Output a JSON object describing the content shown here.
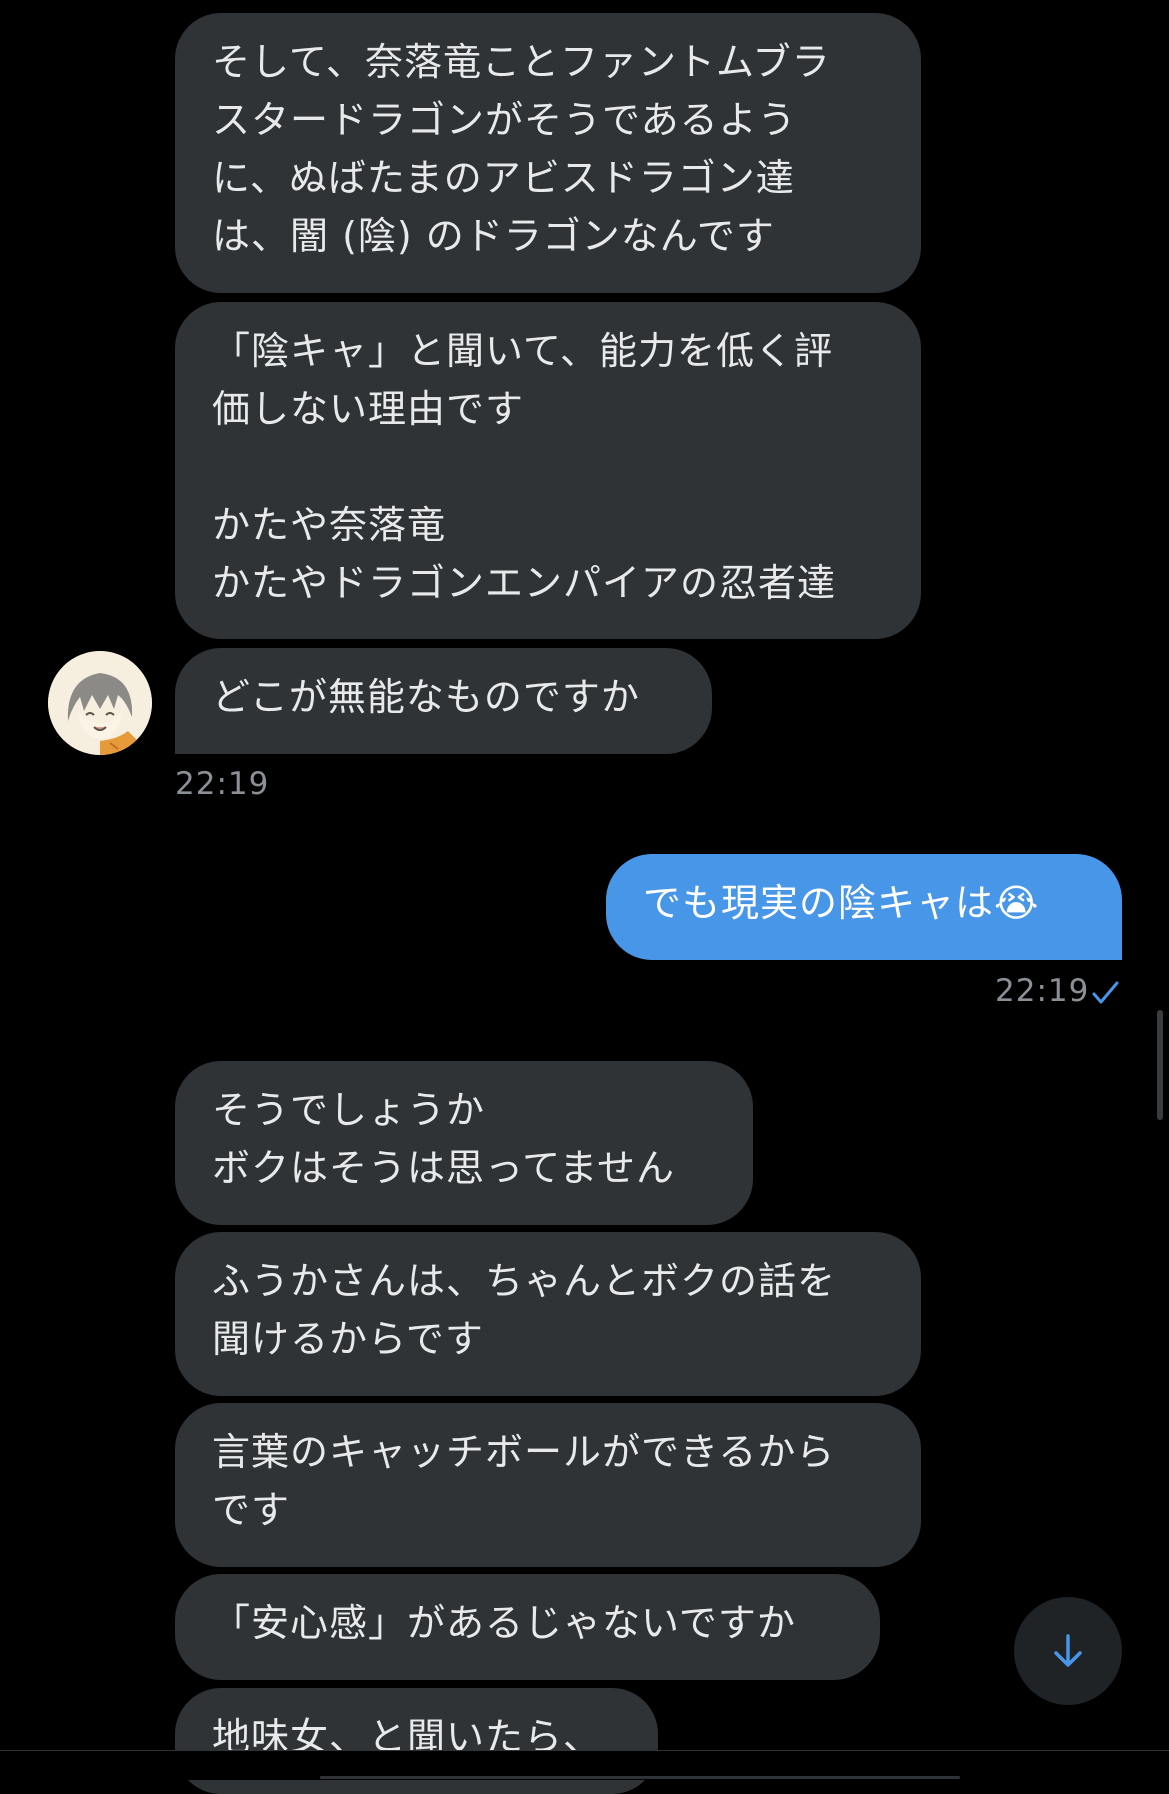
{
  "theme": {
    "background": "#000000",
    "incoming_bubble": "#2f3336",
    "outgoing_bubble": "#4896e8",
    "timestamp_color": "#8b9096",
    "check_color": "#4896e8"
  },
  "messages": [
    {
      "direction": "incoming",
      "text": "そして、奈落竜ことファントムブラ\nスタードラゴンがそうであるよう\nに、ぬばたまのアビスドラゴン達\nは、闇 (陰) のドラゴンなんです"
    },
    {
      "direction": "incoming",
      "text": "「陰キャ」と聞いて、能力を低く評\n価しない理由です\n\nかたや奈落竜\nかたやドラゴンエンパイアの忍者達"
    },
    {
      "direction": "incoming",
      "text": "どこが無能なものですか"
    },
    {
      "direction": "outgoing",
      "text": "でも現実の陰キャは😭"
    },
    {
      "direction": "incoming",
      "text": "そうでしょうか\nボクはそうは思ってません"
    },
    {
      "direction": "incoming",
      "text": "ふうかさんは、ちゃんとボクの話を\n聞けるからです"
    },
    {
      "direction": "incoming",
      "text": "言葉のキャッチボールができるから\nです"
    },
    {
      "direction": "incoming",
      "text": "「安心感」があるじゃないですか"
    },
    {
      "direction": "incoming",
      "text": "地味女、と聞いたら、"
    }
  ],
  "timestamps": {
    "incoming_group_1": "22:19",
    "outgoing_1": "22:19"
  },
  "icons": {
    "avatar": "avatar-anime-character",
    "read_receipt": "check-icon",
    "scroll_down": "arrow-down-icon"
  }
}
